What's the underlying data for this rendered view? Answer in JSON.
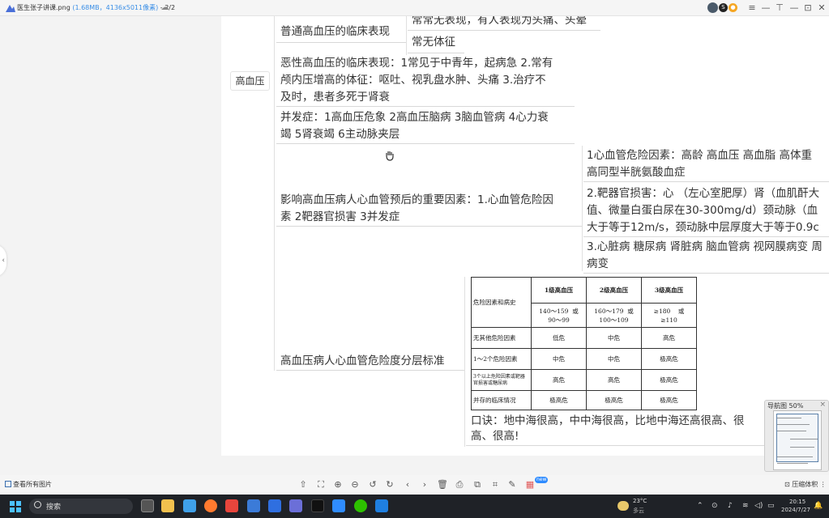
{
  "title_bar": {
    "filename": "医生张子讲课.png",
    "meta": "(1.68MB，4136x5011像素)",
    "page": "- 2/2",
    "buttons": [
      "≡",
      "—",
      "⊡",
      "✕"
    ]
  },
  "mindmap": {
    "root": "高血压",
    "normal_hypertension": "普通高血压的临床表现",
    "normal_detail_1": "常常无表现，有人表现为头痛、头晕",
    "normal_detail_2": "常无体征",
    "malignant_line1": "恶性高血压的临床表现：1常见于中青年，起病急 2.常有",
    "malignant_line2": "颅内压增高的体征：呕吐、视乳盘水肿、头痛 3.治疗不",
    "malignant_line3": "及时，患者多死于肾衰",
    "complication_line1": "并发症：1高血压危象 2高血压脑病 3脑血管病 4心力衰",
    "complication_line2": "竭 5肾衰竭 6主动脉夹层",
    "prognosis_line1": "影响高血压病人心血管预后的重要因素：1.心血管危险因",
    "prognosis_line2": "素 2靶器官损害 3并发症",
    "factor1_line1": "1心血管危险因素：高龄 高血压 高血脂 高体重",
    "factor1_line2": "高同型半胱氨酸血症",
    "factor2_line1": "2.靶器官损害：心 （左心室肥厚）肾（血肌酐大",
    "factor2_line2": "值、微量白蛋白尿在30-300mg/d）颈动脉（血",
    "factor2_line3": "大于等于12m/s，颈动脉中层厚度大于等于0.9c",
    "factor3_line1": "3.心脏病 糖尿病 肾脏病 脑血管病 视网膜病变 周",
    "factor3_line2": "病变",
    "risk_strat": "高血压病人心血管危险度分层标准",
    "mnemonic_line1": "口诀：地中海很高，中中海很高，比地中海还高很高、很",
    "mnemonic_line2": "高、很高!"
  },
  "risk_table": {
    "corner": "危险因素和病史",
    "headers": [
      "1级高血压",
      "2级高血压",
      "3级高血压"
    ],
    "ranges": [
      {
        "a": "140～159",
        "b": "或",
        "c": "90～99"
      },
      {
        "a": "160～179",
        "b": "或",
        "c": "100～109"
      },
      {
        "a": "≥180",
        "b": "或",
        "c": "≥110"
      }
    ],
    "rows": [
      {
        "label": "无其他危险因素",
        "cells": [
          "低危",
          "中危",
          "高危"
        ]
      },
      {
        "label": "1～2个危险因素",
        "cells": [
          "中危",
          "中危",
          "极高危"
        ]
      },
      {
        "label": "3个以上危险因素或靶器官损害或糖尿病",
        "cells": [
          "高危",
          "高危",
          "极高危"
        ]
      },
      {
        "label": "并存的临床情况",
        "cells": [
          "极高危",
          "极高危",
          "极高危"
        ]
      }
    ]
  },
  "thumbnail": {
    "label": "导航图 50%"
  },
  "bottom_toolbar": {
    "all_images": "查看所有图片",
    "new_badge": "new",
    "compress": "压缩体积"
  },
  "taskbar": {
    "search_placeholder": "搜索",
    "weather_temp": "23°C",
    "weather_desc": "多云",
    "time": "20:15",
    "date": "2024/7/27"
  },
  "colors": {
    "accent_blue": "#3a8ee6",
    "taskbar_bg": "#1f2227",
    "canvas_bg": "#ffffff"
  }
}
